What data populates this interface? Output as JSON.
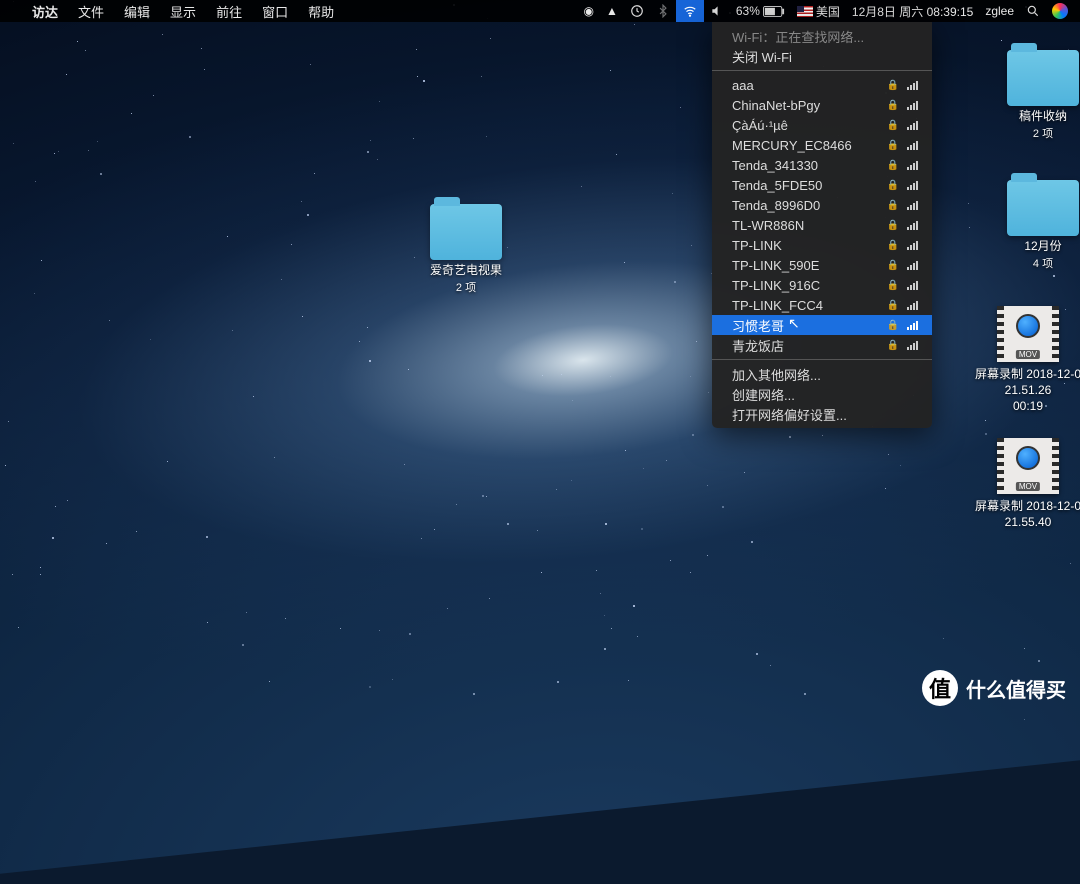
{
  "menubar": {
    "apple": "",
    "items": [
      "访达",
      "文件",
      "编辑",
      "显示",
      "前往",
      "窗口",
      "帮助"
    ],
    "battery_pct": "63%",
    "input_label": "美国",
    "datetime": "12月8日 周六 08:39:15",
    "user": "zglee",
    "search_icon": "search-icon",
    "siri_icon": "siri-icon"
  },
  "wifi": {
    "status": "Wi-Fi：正在查找网络...",
    "turn_off": "关闭 Wi-Fi",
    "networks": [
      {
        "name": "aaa",
        "locked": true
      },
      {
        "name": "ChinaNet-bPgy",
        "locked": true
      },
      {
        "name": "ÇàÁú·¹µê",
        "locked": true
      },
      {
        "name": "MERCURY_EC8466",
        "locked": true
      },
      {
        "name": "Tenda_341330",
        "locked": true
      },
      {
        "name": "Tenda_5FDE50",
        "locked": true
      },
      {
        "name": "Tenda_8996D0",
        "locked": true
      },
      {
        "name": "TL-WR886N",
        "locked": true
      },
      {
        "name": "TP-LINK",
        "locked": true
      },
      {
        "name": "TP-LINK_590E",
        "locked": true
      },
      {
        "name": "TP-LINK_916C",
        "locked": true
      },
      {
        "name": "TP-LINK_FCC4",
        "locked": true
      },
      {
        "name": "习惯老哥",
        "locked": true,
        "selected": true
      },
      {
        "name": "青龙饭店",
        "locked": true
      }
    ],
    "join_other": "加入其他网络...",
    "create": "创建网络...",
    "open_prefs": "打开网络偏好设置..."
  },
  "desktop_icons": {
    "center_folder": {
      "name": "爱奇艺电视果",
      "sub": "2 项"
    },
    "right_folders": [
      {
        "name": "稿件收纳",
        "sub": "2 项"
      },
      {
        "name": "12月份",
        "sub": "4 项"
      }
    ],
    "movies": [
      {
        "line1": "屏幕录制 2018-12-0",
        "line2": "21.51.26",
        "dur": "00:19",
        "tag": "MOV"
      },
      {
        "line1": "屏幕录制 2018-12-0",
        "line2": "21.55.40",
        "tag": "MOV"
      }
    ]
  },
  "watermark": "什么值得买"
}
